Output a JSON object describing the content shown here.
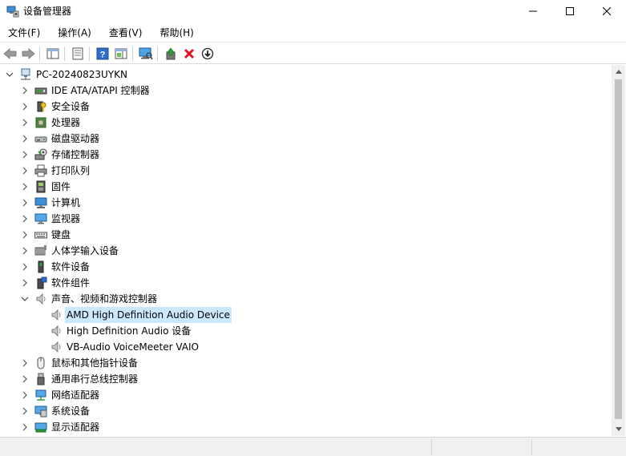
{
  "window": {
    "title": "设备管理器",
    "minimize_label": "—",
    "maximize_label": "☐",
    "close_label": "✕"
  },
  "menu": [
    {
      "label": "文件(F)"
    },
    {
      "label": "操作(A)"
    },
    {
      "label": "查看(V)"
    },
    {
      "label": "帮助(H)"
    }
  ],
  "toolbar": [
    {
      "name": "back-arrow-icon"
    },
    {
      "name": "forward-arrow-icon"
    },
    {
      "name": "show-hide-console-tree-icon"
    },
    {
      "name": "properties-icon"
    },
    {
      "name": "help-icon"
    },
    {
      "name": "action-pane-icon"
    },
    {
      "name": "scan-hardware-changes-icon"
    },
    {
      "name": "update-driver-icon"
    },
    {
      "name": "uninstall-device-icon"
    },
    {
      "name": "enable-device-icon"
    }
  ],
  "tree": {
    "root": {
      "label": "PC-20240823UYKN",
      "icon": "computer-network-icon",
      "expanded": true
    },
    "categories": [
      {
        "label": "IDE ATA/ATAPI 控制器",
        "icon": "ide-controller-icon",
        "expanded": false
      },
      {
        "label": "安全设备",
        "icon": "security-device-icon",
        "expanded": false
      },
      {
        "label": "处理器",
        "icon": "processor-icon",
        "expanded": false
      },
      {
        "label": "磁盘驱动器",
        "icon": "disk-drive-icon",
        "expanded": false
      },
      {
        "label": "存储控制器",
        "icon": "storage-controller-icon",
        "expanded": false
      },
      {
        "label": "打印队列",
        "icon": "printer-icon",
        "expanded": false
      },
      {
        "label": "固件",
        "icon": "firmware-icon",
        "expanded": false
      },
      {
        "label": "计算机",
        "icon": "computer-icon",
        "expanded": false
      },
      {
        "label": "监视器",
        "icon": "monitor-icon",
        "expanded": false
      },
      {
        "label": "键盘",
        "icon": "keyboard-icon",
        "expanded": false
      },
      {
        "label": "人体学输入设备",
        "icon": "hid-icon",
        "expanded": false
      },
      {
        "label": "软件设备",
        "icon": "software-device-icon",
        "expanded": false
      },
      {
        "label": "软件组件",
        "icon": "software-component-icon",
        "expanded": false
      },
      {
        "label": "声音、视频和游戏控制器",
        "icon": "speaker-icon",
        "expanded": true,
        "children": [
          {
            "label": "AMD High Definition Audio Device",
            "icon": "speaker-icon",
            "selected": true
          },
          {
            "label": "High Definition Audio 设备",
            "icon": "speaker-icon",
            "selected": false
          },
          {
            "label": "VB-Audio VoiceMeeter VAIO",
            "icon": "speaker-icon",
            "selected": false
          }
        ]
      },
      {
        "label": "鼠标和其他指针设备",
        "icon": "mouse-icon",
        "expanded": false
      },
      {
        "label": "通用串行总线控制器",
        "icon": "usb-icon",
        "expanded": false
      },
      {
        "label": "网络适配器",
        "icon": "network-adapter-icon",
        "expanded": false
      },
      {
        "label": "系统设备",
        "icon": "system-device-icon",
        "expanded": false
      },
      {
        "label": "显示适配器",
        "icon": "display-adapter-icon",
        "expanded": false
      }
    ]
  },
  "colors": {
    "selection": "#cce8ff",
    "accent_blue": "#0078d7",
    "uninstall_red": "#e81123",
    "update_green": "#2e9e3a"
  }
}
